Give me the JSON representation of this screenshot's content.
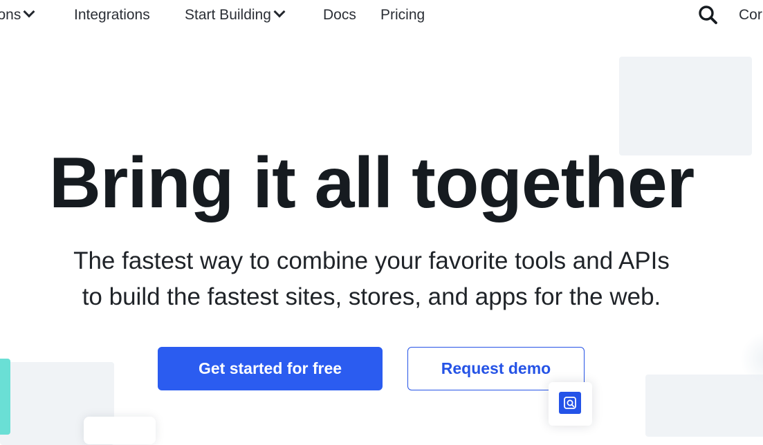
{
  "nav": {
    "items": [
      {
        "label": "tions",
        "has_dropdown": true
      },
      {
        "label": "Integrations",
        "has_dropdown": false
      },
      {
        "label": "Start Building",
        "has_dropdown": true
      },
      {
        "label": "Docs",
        "has_dropdown": false
      },
      {
        "label": "Pricing",
        "has_dropdown": false
      }
    ],
    "search_icon": "search-icon",
    "cut_label": "Cor"
  },
  "hero": {
    "title": "Bring it all together",
    "subtitle_line1": "The fastest way to combine your favorite tools and APIs",
    "subtitle_line2": "to build the fastest sites, stores, and apps for the web."
  },
  "cta": {
    "primary_label": "Get started for free",
    "secondary_label": "Request demo"
  },
  "widget": {
    "icon": "chat-widget-icon"
  },
  "colors": {
    "accent": "#2b5cf0",
    "text_dark": "#161b20",
    "panel": "#f0f3f6",
    "teal": "#6adfd5"
  }
}
